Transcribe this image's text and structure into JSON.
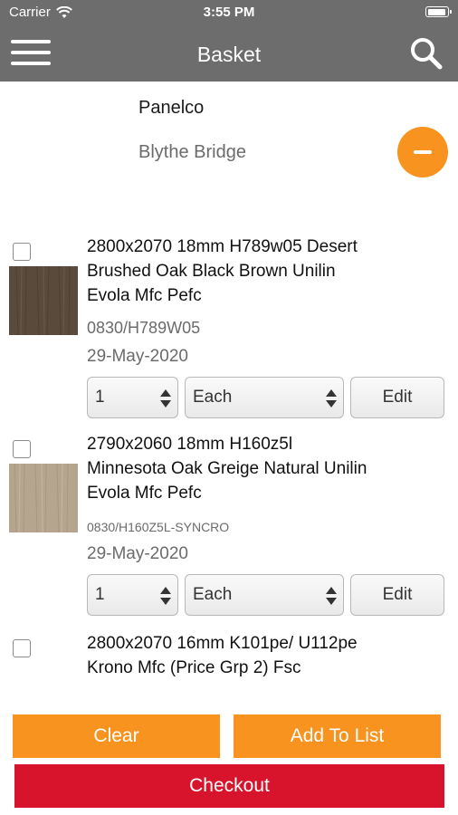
{
  "status_bar": {
    "carrier": "Carrier",
    "time": "3:55 PM",
    "battery_level": 0.95
  },
  "nav": {
    "title": "Basket",
    "menu_icon": "hamburger-menu-icon",
    "search_icon": "search-icon"
  },
  "customer": {
    "company": "Panelco",
    "branch": "Blythe Bridge",
    "remove_icon": "minus-icon"
  },
  "colors": {
    "nav_bg": "#6d6d6d",
    "accent_orange": "#f7931e",
    "checkout_red": "#d7142b"
  },
  "items": [
    {
      "description": "2800x2070 18mm H789w05 Desert Brushed Oak Black Brown Unilin Evola Mfc Pefc",
      "code": "0830/H789W05",
      "date": "29-May-2020",
      "quantity": "1",
      "unit": "Each",
      "edit_label": "Edit",
      "swatch_color": "#5a4a3c",
      "checked": false
    },
    {
      "description": "2790x2060 18mm H160z5l Minnesota Oak Greige Natural Unilin Evola Mfc Pefc",
      "code": "0830/H160Z5L-SYNCRO",
      "date": "29-May-2020",
      "quantity": "1",
      "unit": "Each",
      "edit_label": "Edit",
      "swatch_color": "#b5a58f",
      "checked": false
    },
    {
      "description": "2800x2070 16mm K101pe/ U112pe Krono Mfc (Price Grp 2) Fsc",
      "checked": false
    }
  ],
  "actions": {
    "clear": "Clear",
    "add_to_list": "Add To List",
    "checkout": "Checkout"
  }
}
